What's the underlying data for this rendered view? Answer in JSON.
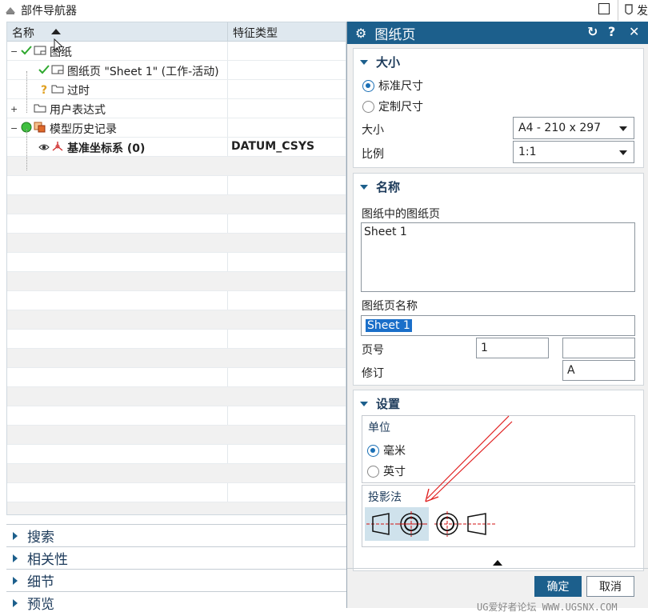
{
  "navigator": {
    "title": "部件导航器",
    "right_tab_text": "发",
    "columns": [
      "名称",
      "特征类型"
    ],
    "rows": [
      {
        "toggle": "−",
        "indent": 4,
        "status": "check",
        "icon": "drawing-icon",
        "label": "图纸",
        "type": ""
      },
      {
        "toggle": "",
        "indent": 38,
        "status": "check",
        "icon": "sheet-icon",
        "label": "图纸页 \"Sheet 1\" (工作-活动)",
        "type": ""
      },
      {
        "toggle": "",
        "indent": 38,
        "status": "question",
        "icon": "folder-icon",
        "label": "过时",
        "type": ""
      },
      {
        "toggle": "+",
        "indent": 4,
        "status": "",
        "icon": "folder-icon",
        "label": "用户表达式",
        "type": ""
      },
      {
        "toggle": "−",
        "indent": 4,
        "status": "green-dot",
        "icon": "model-icon",
        "label": "模型历史记录",
        "type": ""
      },
      {
        "toggle": "",
        "indent": 38,
        "status": "eye",
        "icon": "csys-icon",
        "label": "基准坐标系 (0)",
        "type": "DATUM_CSYS"
      }
    ],
    "sections": [
      "搜索",
      "相关性",
      "细节",
      "预览"
    ]
  },
  "dialog": {
    "title": "图纸页",
    "size_group": {
      "header": "大小",
      "radio_standard": "标准尺寸",
      "radio_custom": "定制尺寸",
      "size_label": "大小",
      "size_value": "A4 - 210 x 297",
      "scale_label": "比例",
      "scale_value": "1:1"
    },
    "name_group": {
      "header": "名称",
      "sheets_label": "图纸中的图纸页",
      "sheets_list": "Sheet 1",
      "sheet_name_label": "图纸页名称",
      "sheet_name_value": "Sheet 1",
      "page_label": "页号",
      "page_value": "1",
      "page_value2": "",
      "revision_label": "修订",
      "revision_value": "A"
    },
    "settings_group": {
      "header": "设置",
      "units_title": "单位",
      "unit_mm": "毫米",
      "unit_inch": "英寸",
      "projection_title": "投影法"
    },
    "ok_label": "确定",
    "cancel_label": "取消"
  },
  "watermark": "UG爱好者论坛 WWW.UGSNX.COM",
  "colors": {
    "accent": "#1c5f8c",
    "check": "#2ea82e",
    "annotation_arrow": "#e02020"
  }
}
